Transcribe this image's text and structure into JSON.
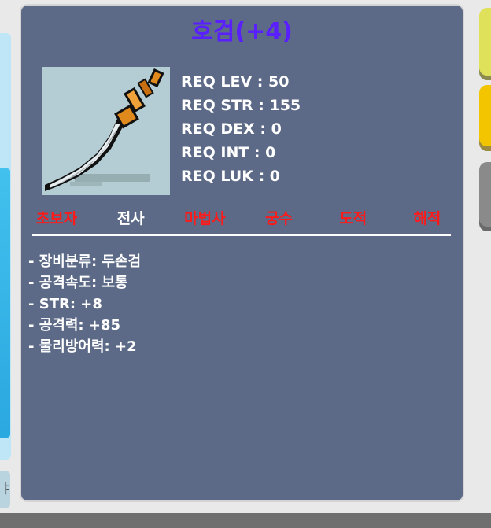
{
  "item": {
    "name": "호검(+4)",
    "requirements": [
      "REQ LEV : 50",
      "REQ STR : 155",
      "REQ DEX : 0",
      "REQ INT : 0",
      "REQ LUK : 0"
    ],
    "jobs": [
      {
        "label": "초보자",
        "allowed": false
      },
      {
        "label": "전사",
        "allowed": true
      },
      {
        "label": "마법사",
        "allowed": false
      },
      {
        "label": "궁수",
        "allowed": false
      },
      {
        "label": "도적",
        "allowed": false
      },
      {
        "label": "해적",
        "allowed": false
      }
    ],
    "stats": [
      "- 장비분류: 두손검",
      "- 공격속도: 보통",
      "- STR: +8",
      "- 공격력: +85",
      "- 물리방어력: +2"
    ],
    "icon": "curved-sword-icon"
  },
  "left_panel": {
    "button_text": "ㅑ"
  },
  "colors": {
    "title": "#5a1fff",
    "panel_bg": "#5c6a88",
    "job_allowed": "#ffffff",
    "job_disallowed": "#ff1a1a"
  }
}
